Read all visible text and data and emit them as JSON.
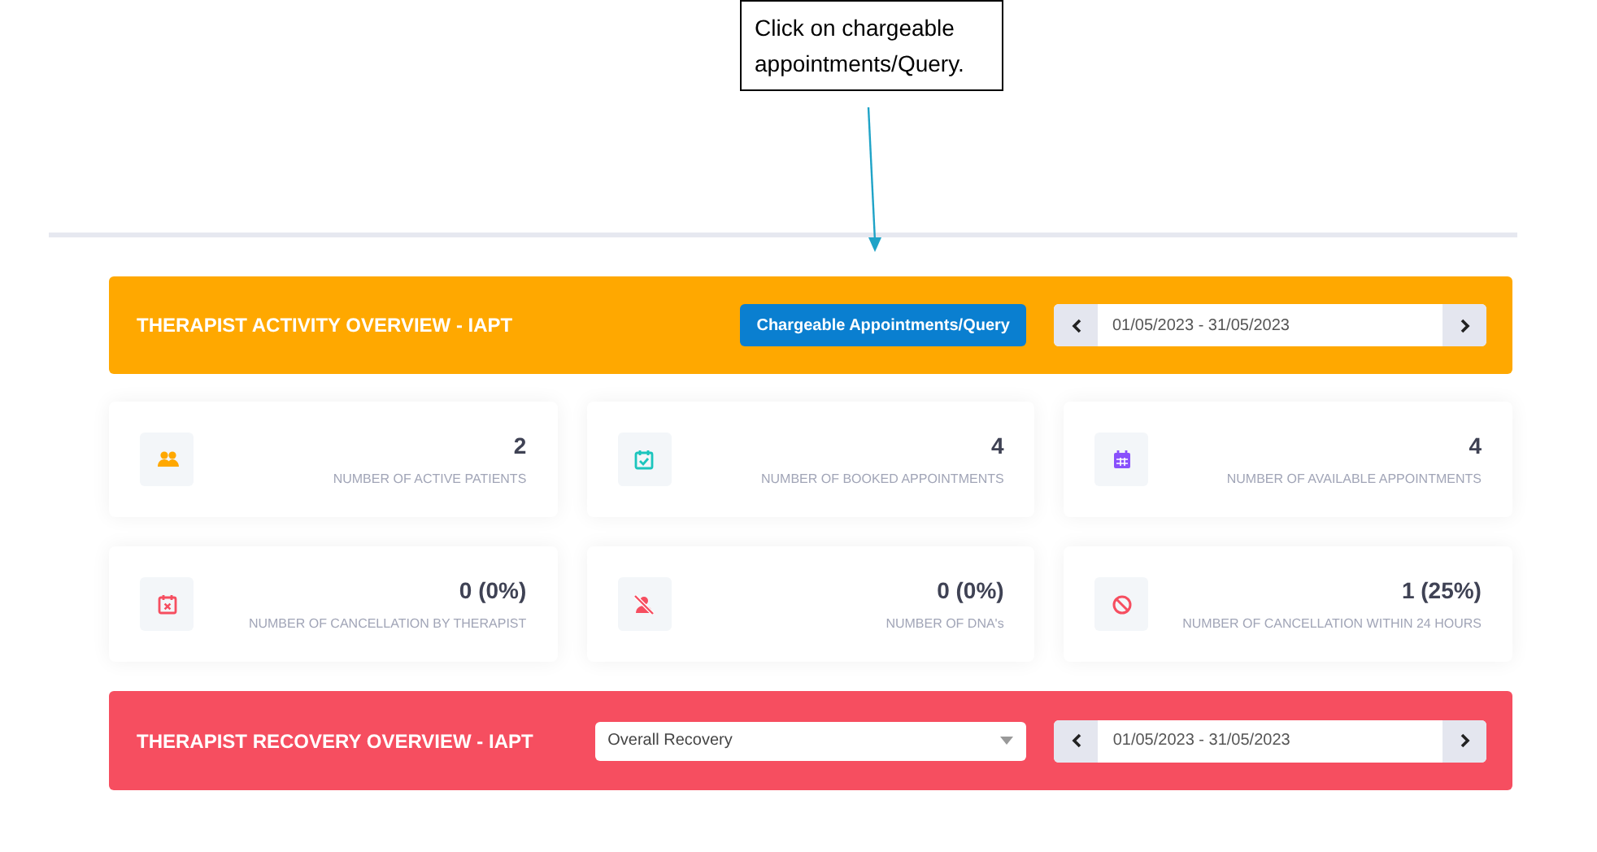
{
  "annotation": {
    "text": "Click on chargeable appointments/Query."
  },
  "activity_panel": {
    "title": "THERAPIST ACTIVITY OVERVIEW - IAPT",
    "button": "Chargeable Appointments/Query",
    "date_range": "01/05/2023 - 31/05/2023"
  },
  "stats": [
    {
      "kind": "people",
      "value": "2",
      "label": "NUMBER OF ACTIVE PATIENTS"
    },
    {
      "kind": "calendar-check",
      "value": "4",
      "label": "NUMBER OF BOOKED APPOINTMENTS"
    },
    {
      "kind": "calendar-grid",
      "value": "4",
      "label": "NUMBER OF AVAILABLE APPOINTMENTS"
    },
    {
      "kind": "calendar-x",
      "value": "0 (0%)",
      "label": "NUMBER OF CANCELLATION BY THERAPIST"
    },
    {
      "kind": "user-off",
      "value": "0 (0%)",
      "label": "NUMBER OF DNA's"
    },
    {
      "kind": "ban",
      "value": "1 (25%)",
      "label": "NUMBER OF CANCELLATION WITHIN 24 HOURS"
    }
  ],
  "recovery_panel": {
    "title": "THERAPIST RECOVERY OVERVIEW - IAPT",
    "dropdown": "Overall Recovery",
    "date_range": "01/05/2023 - 31/05/2023"
  }
}
